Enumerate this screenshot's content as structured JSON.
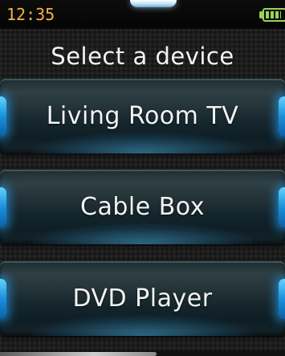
{
  "status_bar": {
    "time": "12:35",
    "battery_level": 0.85,
    "battery_icon": "battery-icon",
    "colors": {
      "clock": "#f2b24a",
      "battery": "#9ad25a"
    }
  },
  "page": {
    "title": "Select a device"
  },
  "devices": [
    {
      "label": "Living Room TV"
    },
    {
      "label": "Cable Box"
    },
    {
      "label": "DVD Player"
    }
  ],
  "colors": {
    "background": "#1d1d1d",
    "button": "#223237",
    "accent_glow": "#1a8fdb",
    "text": "#f3f3f3"
  }
}
